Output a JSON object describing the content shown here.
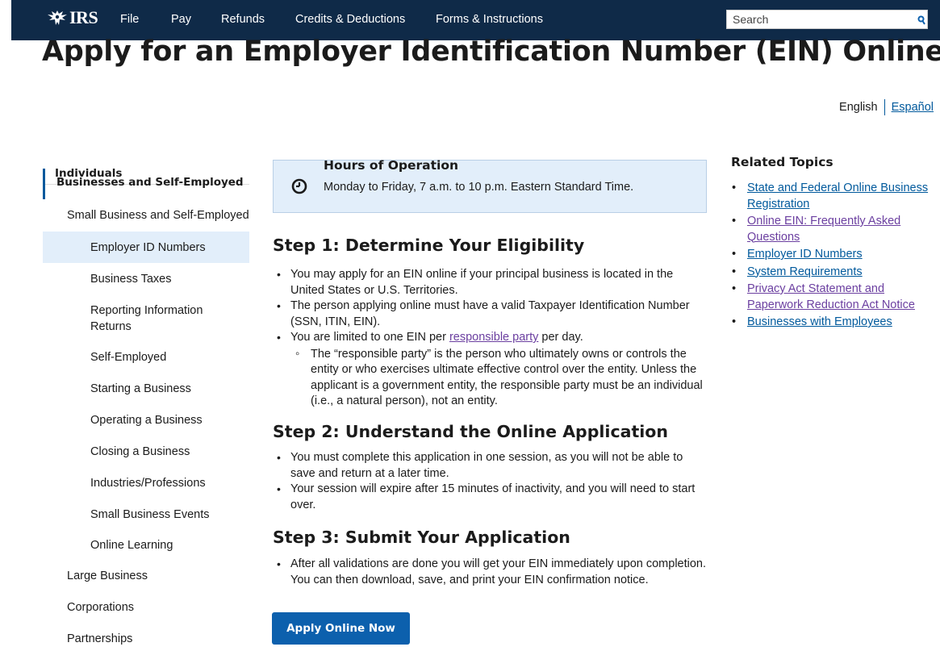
{
  "header": {
    "logo_text": "IRS",
    "nav": [
      "File",
      "Pay",
      "Refunds",
      "Credits & Deductions",
      "Forms & Instructions"
    ],
    "search_placeholder": "Search"
  },
  "page_title": "Apply for an Employer Identification Number (EIN) Online",
  "language": {
    "current": "English",
    "alternate": "Español"
  },
  "sidebar": {
    "top": "Individuals",
    "active": "Businesses and Self-Employed",
    "sub": "Small Business and Self-Employed",
    "children": [
      "Employer ID Numbers",
      "Business Taxes",
      "Reporting Information Returns",
      "Self-Employed",
      "Starting a Business",
      "Operating a Business",
      "Closing a Business",
      "Industries/Professions",
      "Small Business Events",
      "Online Learning"
    ],
    "siblings": [
      "Large Business",
      "Corporations",
      "Partnerships"
    ]
  },
  "hours": {
    "title": "Hours of Operation",
    "text": "Monday to Friday, 7 a.m. to 10 p.m. Eastern Standard Time."
  },
  "steps": [
    {
      "heading": "Step 1: Determine Your Eligibility",
      "bullets": [
        "You may apply for an EIN online if your principal business is located in the United States or U.S. Territories.",
        "The person applying online must have a valid Taxpayer Identification Number (SSN, ITIN, EIN)."
      ],
      "limit_prefix": "You are limited to one EIN per ",
      "limit_link": "responsible party",
      "limit_suffix": " per day.",
      "sub_bullet": "The “responsible party” is the person who ultimately owns or controls the entity or who exercises ultimate effective control over the entity. Unless the applicant is a government entity, the responsible party must be an individual (i.e., a natural person), not an entity."
    },
    {
      "heading": "Step 2: Understand the Online Application",
      "bullets": [
        "You must complete this application in one session, as you will not be able to save and return at a later time.",
        "Your session will expire after 15 minutes of inactivity, and you will need to start over."
      ]
    },
    {
      "heading": "Step 3: Submit Your Application",
      "bullets": [
        "After all validations are done you will get your EIN immediately upon completion. You can then download, save, and print your EIN confirmation notice."
      ]
    }
  ],
  "apply_button": "Apply Online Now",
  "related": {
    "title": "Related Topics",
    "links": [
      "State and Federal Online Business Registration",
      "Online EIN: Frequently Asked Questions",
      "Employer ID Numbers",
      "System Requirements",
      "Privacy Act Statement and Paperwork Reduction Act Notice",
      "Businesses with Employees"
    ]
  },
  "colors": {
    "header_bg": "#0f2a48",
    "link": "#00599c",
    "visited_link": "#6b3fa0",
    "button": "#0c60ad",
    "highlight_bg": "#e2eefa"
  }
}
